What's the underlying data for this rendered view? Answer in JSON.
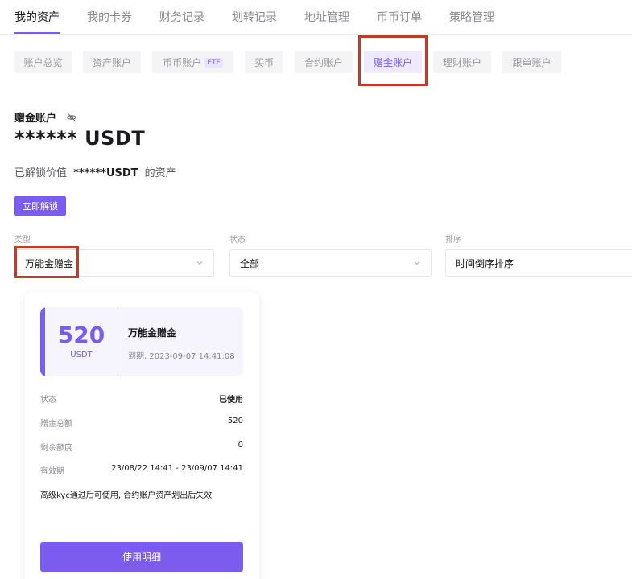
{
  "top_tabs": [
    "我的资产",
    "我的卡券",
    "财务记录",
    "划转记录",
    "地址管理",
    "币币订单",
    "策略管理"
  ],
  "sub_tabs": [
    "账户总览",
    "资产账户",
    "币币账户",
    "买币",
    "合约账户",
    "赠金账户",
    "理财账户",
    "跟单账户"
  ],
  "etf_badge": "ETF",
  "account": {
    "label": "赠金账户",
    "amount": "****** USDT",
    "unlock_prefix": "已解锁价值",
    "unlock_value": "******USDT",
    "unlock_suffix": "的资产",
    "unlock_button": "立即解锁"
  },
  "filters": {
    "type_label": "类型",
    "type_value": "万能金赠金",
    "status_label": "状态",
    "status_value": "全部",
    "sort_label": "排序",
    "sort_value": "时间倒序排序"
  },
  "card": {
    "amount": "520",
    "unit": "USDT",
    "title": "万能金赠金",
    "expiry": "到期, 2023-09-07 14:41:08",
    "rows": [
      {
        "key": "状态",
        "value": "已使用"
      },
      {
        "key": "赠金总额",
        "value": "520"
      },
      {
        "key": "剩余额度",
        "value": "0"
      },
      {
        "key": "有效期",
        "value": "23/08/22 14:41 - 23/09/07 14:41"
      }
    ],
    "note": "高级kyc通过后可使用, 合约账户资产划出后失效",
    "detail_button": "使用明细"
  },
  "colors": {
    "accent": "#7b5cf0",
    "highlight_box": "#c23a2a"
  }
}
